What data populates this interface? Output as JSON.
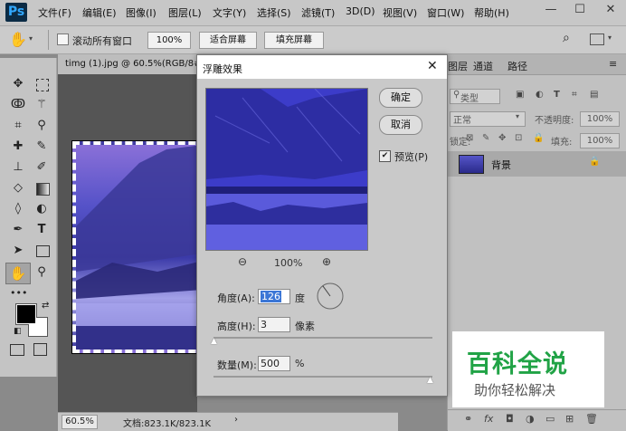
{
  "menubar": {
    "logo": "Ps",
    "items": [
      "文件(F)",
      "编辑(E)",
      "图像(I)",
      "图层(L)",
      "文字(Y)",
      "选择(S)",
      "滤镜(T)",
      "3D(D)",
      "视图(V)",
      "窗口(W)",
      "帮助(H)"
    ],
    "window_controls": [
      "—",
      "☐",
      "✕"
    ]
  },
  "optbar": {
    "scroll_all_label": "滚动所有窗口",
    "zoom_value": "100%",
    "fit_screen": "适合屏幕",
    "fill_screen": "填充屏幕"
  },
  "document": {
    "tab_title": "timg (1).jpg @ 60.5%(RGB/8#",
    "zoom": "60.5%",
    "doc_info": "文档:823.1K/823.1K"
  },
  "panel": {
    "tabs": [
      "图层",
      "通道",
      "路径"
    ],
    "kind_label": "类型",
    "blend_mode": "正常",
    "opacity_label": "不透明度:",
    "opacity_value": "100%",
    "lock_label": "锁定:",
    "fill_label": "填充:",
    "fill_value": "100%",
    "layer_name": "背景",
    "footer_icons": [
      "link-icon",
      "fx",
      "mask-icon",
      "adjust-icon",
      "folder-icon",
      "new-layer-icon",
      "trash-icon"
    ]
  },
  "dialog": {
    "title": "浮雕效果",
    "ok": "确定",
    "cancel": "取消",
    "preview_label": "预览(P)",
    "preview_checked": true,
    "zoom_level": "100%",
    "angle_label": "角度(A):",
    "angle_value": "126",
    "angle_unit": "度",
    "height_label": "高度(H):",
    "height_value": "3",
    "height_unit": "像素",
    "amount_label": "数量(M):",
    "amount_value": "500",
    "amount_unit": "%"
  },
  "watermark": {
    "title": "百科全说",
    "subtitle": "助你轻松解决",
    "color": "#21a346"
  }
}
